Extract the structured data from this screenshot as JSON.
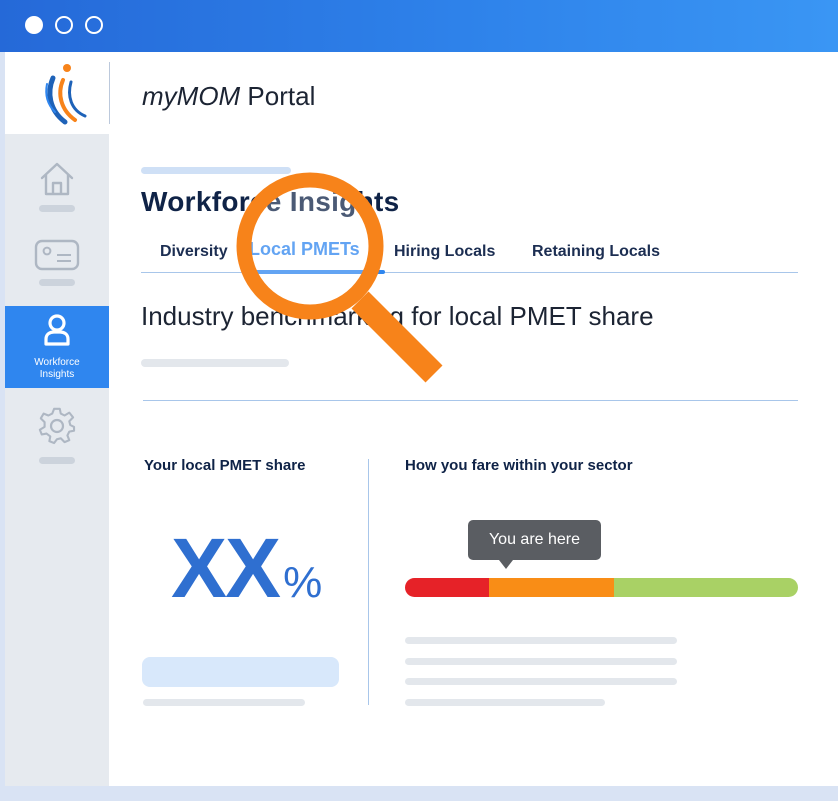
{
  "window": {
    "controls": [
      "close",
      "minimize",
      "maximize"
    ]
  },
  "header": {
    "app_name_italic": "myMOM",
    "app_name_rest": " Portal"
  },
  "sidebar": {
    "items": [
      {
        "icon": "home-icon",
        "active": false
      },
      {
        "icon": "id-card-icon",
        "active": false
      },
      {
        "icon": "person-icon",
        "label_line1": "Workforce",
        "label_line2": "Insights",
        "active": true
      },
      {
        "icon": "gear-icon",
        "active": false
      }
    ]
  },
  "main": {
    "page_title": "Workforce Insights",
    "tabs": [
      {
        "label": "Diversity"
      },
      {
        "label": "Local PMETs",
        "active": true
      },
      {
        "label": "Hiring Locals"
      },
      {
        "label": "Retaining Locals"
      }
    ],
    "section_heading": "Industry benchmarking for local PMET share",
    "left_card": {
      "label": "Your local PMET share",
      "value": "XX",
      "unit": "%"
    },
    "right_card": {
      "label": "How you fare within your sector",
      "tooltip": "You are here",
      "indicator_position": "middle"
    }
  },
  "colors": {
    "accent": "#2f86ef",
    "title_bar": "#2e82ea",
    "page_title": "#0f2347",
    "big_value": "#2f6fd0",
    "magnifier": "#f7831a",
    "bar_low": "#e62228",
    "bar_mid": "#f98d16",
    "bar_high": "#a9d165"
  }
}
